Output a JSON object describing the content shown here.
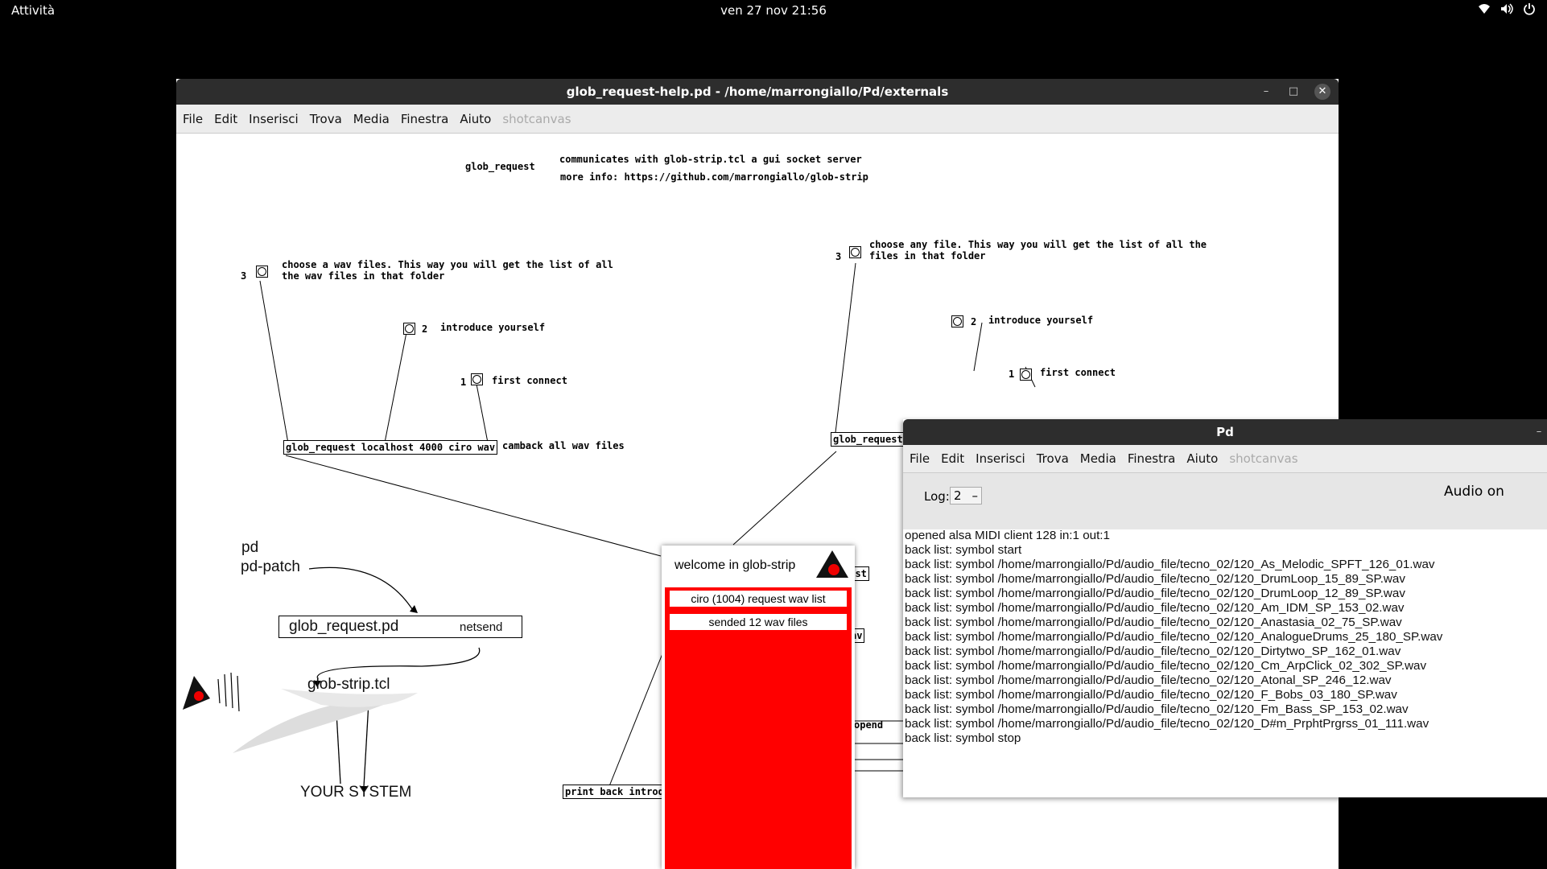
{
  "topbar": {
    "activities": "Attività",
    "clock": "ven 27 nov  21:56",
    "tray_icons": [
      "wifi-icon",
      "volume-icon",
      "power-icon"
    ]
  },
  "main_window": {
    "title": "glob_request-help.pd  - /home/marrongiallo/Pd/externals",
    "menu": [
      "File",
      "Edit",
      "Inserisci",
      "Trova",
      "Media",
      "Finestra",
      "Aiuto",
      "shotcanvas"
    ],
    "patch": {
      "header_name": "glob_request",
      "header_desc1": "communicates with glob-strip.tcl a gui socket server",
      "header_desc2": "more info: https://github.com/marrongiallo/glob-strip",
      "left": {
        "num3": "3",
        "note3a": "choose a wav files. This way you will get the list of all",
        "note3b": "the wav files in that folder",
        "num2": "2",
        "note2": "introduce yourself",
        "num1": "1",
        "note1": "first connect",
        "object": "glob_request localhost 4000 ciro wav",
        "object_note": "camback all wav files"
      },
      "right": {
        "num3": "3",
        "note3a": "choose any file. This way you will get the list of all the",
        "note3b": "files in that folder",
        "num2": "2",
        "note2": "introduce yourself",
        "num1": "1",
        "note1": "first connect",
        "object": "glob_request",
        "frag_uest": "uest",
        "frag_av": "av",
        "frag_opend": "opend"
      },
      "print_object": "print back introd",
      "diagram": {
        "pd": "pd",
        "pd_patch": "pd-patch",
        "box_label": "glob_request.pd",
        "box_netsend": "netsend",
        "tcl": "glob-strip.tcl",
        "system": "YOUR SYSTEM"
      }
    }
  },
  "popup": {
    "title": "welcome in glob-strip",
    "line1": "ciro (1004) request wav list",
    "line2": "sended 12 wav files",
    "bg": "#ff0000"
  },
  "pd_window": {
    "title": "Pd",
    "menu": [
      "File",
      "Edit",
      "Inserisci",
      "Trova",
      "Media",
      "Finestra",
      "Aiuto",
      "shotcanvas"
    ],
    "log_label": "Log:",
    "log_value": "2",
    "audio": "Audio on",
    "console": [
      "opened alsa MIDI client 128 in:1 out:1",
      "back list: symbol start",
      "back list: symbol /home/marrongiallo/Pd/audio_file/tecno_02/120_As_Melodic_SPFT_126_01.wav",
      "back list: symbol /home/marrongiallo/Pd/audio_file/tecno_02/120_DrumLoop_15_89_SP.wav",
      "back list: symbol /home/marrongiallo/Pd/audio_file/tecno_02/120_DrumLoop_12_89_SP.wav",
      "back list: symbol /home/marrongiallo/Pd/audio_file/tecno_02/120_Am_IDM_SP_153_02.wav",
      "back list: symbol /home/marrongiallo/Pd/audio_file/tecno_02/120_Anastasia_02_75_SP.wav",
      "back list: symbol /home/marrongiallo/Pd/audio_file/tecno_02/120_AnalogueDrums_25_180_SP.wav",
      "back list: symbol /home/marrongiallo/Pd/audio_file/tecno_02/120_Dirtytwo_SP_162_01.wav",
      "back list: symbol /home/marrongiallo/Pd/audio_file/tecno_02/120_Cm_ArpClick_02_302_SP.wav",
      "back list: symbol /home/marrongiallo/Pd/audio_file/tecno_02/120_Atonal_SP_246_12.wav",
      "back list: symbol /home/marrongiallo/Pd/audio_file/tecno_02/120_F_Bobs_03_180_SP.wav",
      "back list: symbol /home/marrongiallo/Pd/audio_file/tecno_02/120_Fm_Bass_SP_153_02.wav",
      "back list: symbol /home/marrongiallo/Pd/audio_file/tecno_02/120_D#m_PrphtPrgrss_01_111.wav",
      "back list: symbol stop"
    ]
  }
}
